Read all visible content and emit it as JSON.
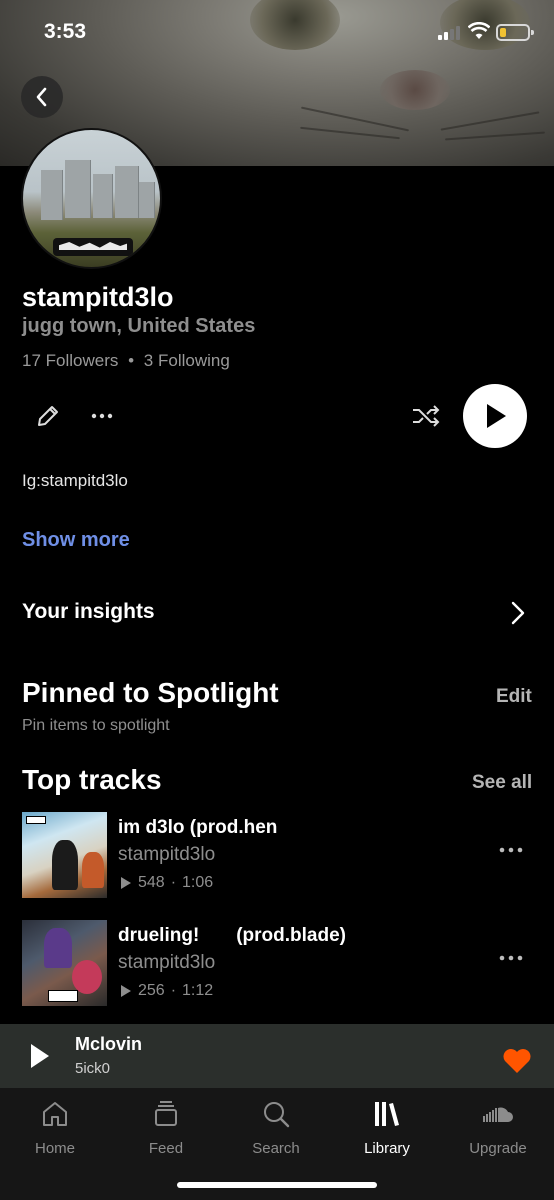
{
  "status_bar": {
    "time": "3:53"
  },
  "profile": {
    "username": "stampitd3lo",
    "location": "jugg town, United States",
    "followers_label": "17 Followers",
    "separator": "•",
    "following_label": "3 Following",
    "bio": "Ig:stampitd3lo",
    "show_more": "Show more"
  },
  "insights": {
    "label": "Your insights"
  },
  "spotlight": {
    "title": "Pinned to Spotlight",
    "edit": "Edit",
    "subtitle": "Pin items to spotlight"
  },
  "top_tracks": {
    "title": "Top tracks",
    "see_all": "See all",
    "items": [
      {
        "title": "im d3lo (prod.hen",
        "artist": "stampitd3lo",
        "plays": "548",
        "duration": "1:06"
      },
      {
        "title": "drueling!       (prod.blade)",
        "artist": "stampitd3lo",
        "plays": "256",
        "duration": "1:12"
      }
    ]
  },
  "mini_player": {
    "title": "Mclovin",
    "artist": "5ick0",
    "heart_color": "#ff5500"
  },
  "tabs": [
    {
      "label": "Home",
      "icon": "home-icon",
      "active": false
    },
    {
      "label": "Feed",
      "icon": "feed-icon",
      "active": false
    },
    {
      "label": "Search",
      "icon": "search-icon",
      "active": false
    },
    {
      "label": "Library",
      "icon": "library-icon",
      "active": true
    },
    {
      "label": "Upgrade",
      "icon": "soundcloud-icon",
      "active": false
    }
  ],
  "colors": {
    "accent_link": "#6f8fe6",
    "background": "#000000",
    "mini_player_bg": "#2b2f2c"
  }
}
